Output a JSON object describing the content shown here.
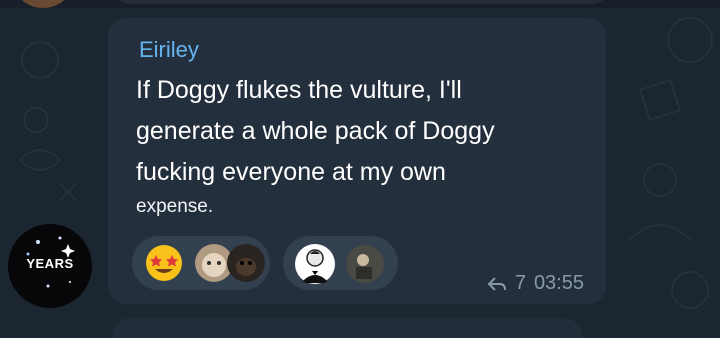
{
  "message": {
    "sender": "Eiriley",
    "lines": [
      "If Doggy flukes the vulture, I'll",
      "generate a whole pack of Doggy",
      "fucking everyone at my own"
    ],
    "last_line": "expense.",
    "reply_count": "7",
    "time": "03:55"
  },
  "reactions": [
    {
      "emoji": "star-struck-face-icon"
    },
    {
      "emoji": "user-avatar-cat-icon"
    },
    {
      "emoji": "user-avatar-dog-icon"
    },
    {
      "emoji": "tuxedo-man-meme-icon"
    },
    {
      "emoji": "user-avatar-photo-icon"
    }
  ],
  "avatar": {
    "text": "YEARS"
  },
  "colors": {
    "background": "#1b2631",
    "bubble": "#242f3d",
    "sender": "#64b5ef",
    "meta": "#8899aa"
  }
}
